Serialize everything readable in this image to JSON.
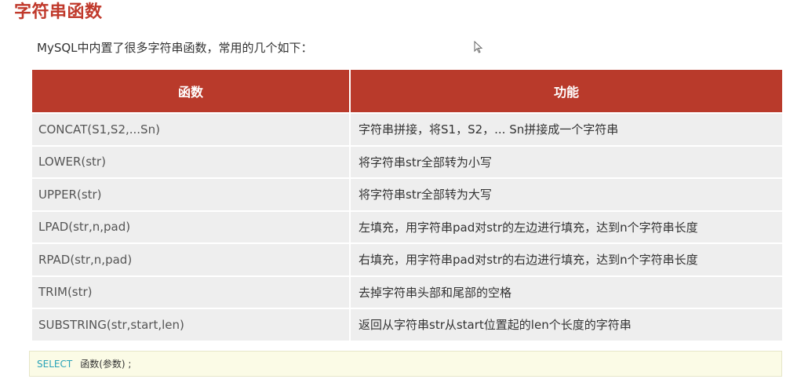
{
  "title": "字符串函数",
  "intro": "MySQL中内置了很多字符串函数，常用的几个如下：",
  "table": {
    "headers": [
      "函数",
      "功能"
    ],
    "rows": [
      {
        "func": "CONCAT(S1,S2,...Sn)",
        "desc": "字符串拼接，将S1，S2，... Sn拼接成一个字符串"
      },
      {
        "func": "LOWER(str)",
        "desc": "将字符串str全部转为小写"
      },
      {
        "func": "UPPER(str)",
        "desc": "将字符串str全部转为大写"
      },
      {
        "func": "LPAD(str,n,pad)",
        "desc": "左填充，用字符串pad对str的左边进行填充，达到n个字符串长度"
      },
      {
        "func": "RPAD(str,n,pad)",
        "desc": "右填充，用字符串pad对str的右边进行填充，达到n个字符串长度"
      },
      {
        "func": "TRIM(str)",
        "desc": "去掉字符串头部和尾部的空格"
      },
      {
        "func": "SUBSTRING(str,start,len)",
        "desc": "返回从字符串str从start位置起的len个长度的字符串"
      }
    ]
  },
  "code": {
    "keyword": "SELECT",
    "rest": "函数(参数) ;"
  },
  "colors": {
    "accent": "#c0392b",
    "header_bg": "#b93a2b",
    "row_bg": "#eeeeee",
    "code_bg": "#fbfbe6",
    "keyword": "#2aa3b8"
  },
  "icons": {
    "cursor": "mouse-pointer-icon"
  }
}
